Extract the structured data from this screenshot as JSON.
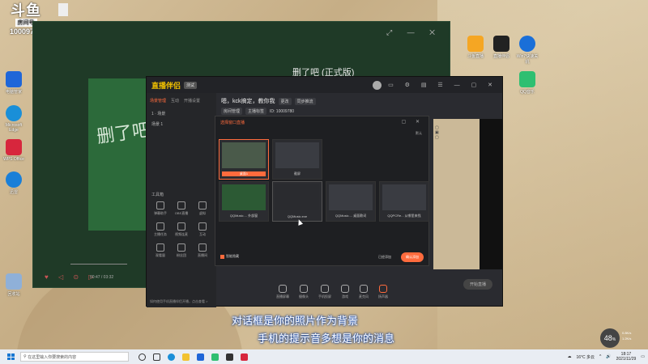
{
  "watermark": {
    "logo": "斗鱼",
    "tag": "房间号",
    "room_number": "10009780"
  },
  "desktop_left_icons": [
    {
      "label": "电脑管家",
      "icon": "shield-icon",
      "color": "#1f66d8"
    },
    {
      "label": "Microsoft Edge",
      "icon": "edge-icon",
      "color": "#1a8fd8"
    },
    {
      "label": "WPS Office",
      "icon": "wps-icon",
      "color": "#d7263d"
    },
    {
      "label": "迅雷",
      "icon": "thunder-icon",
      "color": "#1a7fd8"
    },
    {
      "label": "回收站",
      "icon": "recycle-bin-icon",
      "color": "#8fb0d8"
    }
  ],
  "desktop_right_icons": [
    {
      "label": "斗鱼直播",
      "icon": "app-icon",
      "color": "#f5a623"
    },
    {
      "label": "直播伴侣",
      "icon": "app-icon",
      "color": "#222"
    },
    {
      "label": "Win7快速关机",
      "icon": "app-icon",
      "color": "#1a6fd8"
    },
    {
      "label": "QQ音乐",
      "icon": "app-icon",
      "color": "#2fbf71"
    }
  ],
  "player": {
    "song_title": "删了吧 (正式版)",
    "handwriting": "删了吧",
    "time": "00:47 / 03:32"
  },
  "app": {
    "logo_main": "直播伴侣",
    "logo_suffix": "",
    "version_badge": "测试",
    "side_tabs": [
      "场景管理",
      "互动",
      "开播设置"
    ],
    "scene_rows": [
      "1 · 场景",
      "场景 1"
    ],
    "tools_label": "工具箱",
    "tools": [
      "弹幕助手",
      "OBS直播",
      "虚拟",
      "主播任务",
      "视频连麦",
      "互动",
      "观看量",
      "粉丝团",
      "直播间"
    ],
    "notice": "如何使用手机直播伴侣开播，点击查看 >",
    "head_title": "嗯，kck搞定，教你我",
    "head_chips": [
      "更改",
      "同步推流"
    ],
    "head_row2": [
      "房间管理",
      "主播标签"
    ],
    "head_id": "ID: 10009780",
    "bottom_actions": [
      "直播屏幕",
      "摄像头",
      "手机投屏",
      "游戏",
      "麦克风",
      "扬声器"
    ],
    "start_live": "开始直播"
  },
  "dialog": {
    "title": "选择窗口直播",
    "sort": "默认",
    "windows": [
      {
        "label": "桌面1",
        "state": "selected"
      },
      {
        "label": "截屏",
        "state": "normal"
      },
      {
        "label": "QQMusic.... 外部窗",
        "state": "normal"
      },
      {
        "label": "QQMusic.exe",
        "state": "hover"
      },
      {
        "label": "QQMusic.... 桌面歌词",
        "state": "normal"
      },
      {
        "label": "QQPCRe... 从哪里来找",
        "state": "normal"
      }
    ],
    "checkbox_label": "智能隐藏",
    "cancel": "已经添加",
    "confirm": "确认添加"
  },
  "subtitles": [
    "对话框是你的照片作为背景",
    "手机的提示音多想是你的消息"
  ],
  "speed_widget": {
    "value": "48",
    "unit": "%",
    "up": "0.8K/s",
    "down": "1.2K/s"
  },
  "taskbar": {
    "search_placeholder": "在这里输入你要搜索的内容",
    "weather": "16°C 多云",
    "time": "18:17",
    "date": "2021/11/29"
  }
}
